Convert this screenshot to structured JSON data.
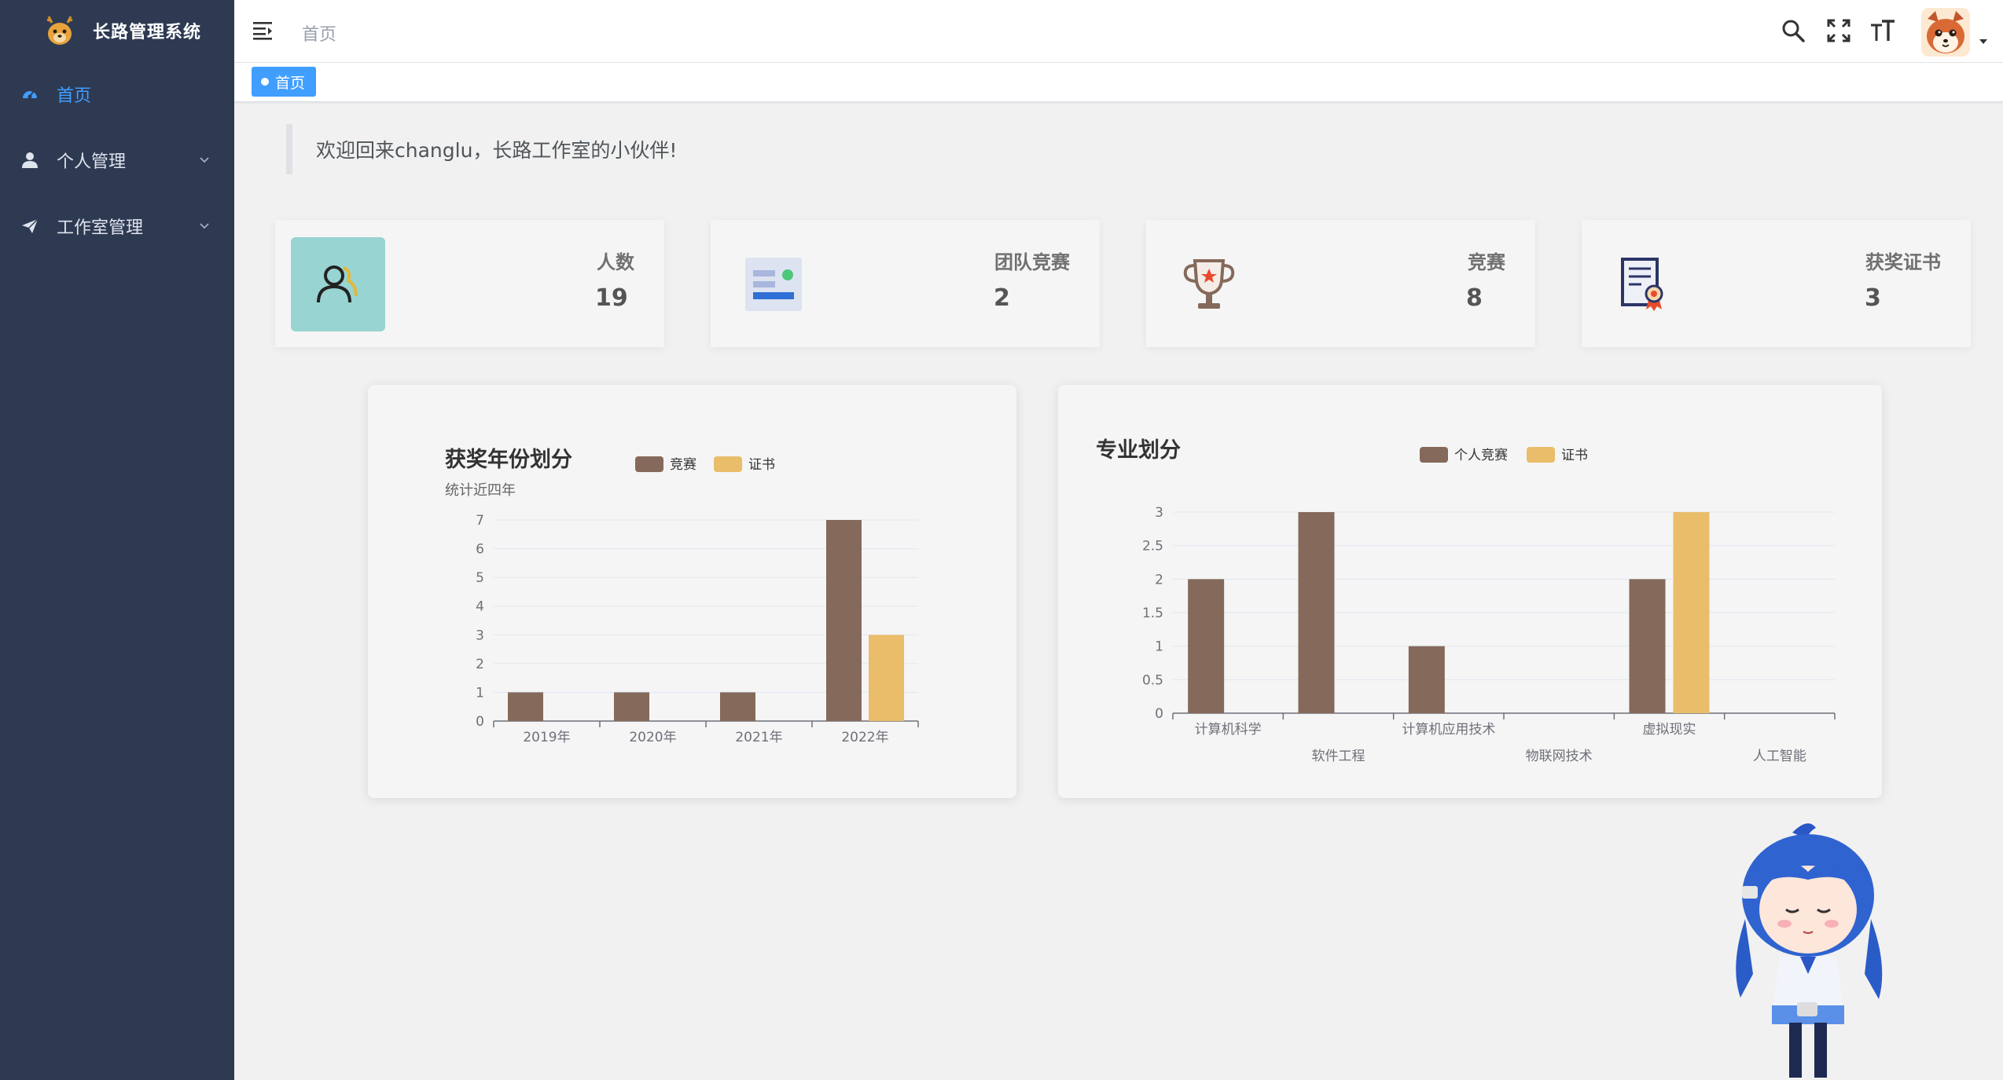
{
  "sidebar": {
    "brand_title": "长路管理系统",
    "items": [
      {
        "label": "首页",
        "icon": "dashboard-icon",
        "active": true
      },
      {
        "label": "个人管理",
        "icon": "user-icon",
        "expandable": true
      },
      {
        "label": "工作室管理",
        "icon": "paper-plane-icon",
        "expandable": true
      }
    ],
    "bg_color": "#2e3a52",
    "active_color": "#409eff"
  },
  "header": {
    "breadcrumb": "首页",
    "icons": [
      "search-icon",
      "fullscreen-icon",
      "font-size-icon"
    ]
  },
  "tags": [
    {
      "label": "首页",
      "active": true
    }
  ],
  "welcome_text": "欢迎回来changlu，长路工作室的小伙伴!",
  "stats": [
    {
      "label": "人数",
      "value": "19",
      "icon": "people-icon"
    },
    {
      "label": "团队竞赛",
      "value": "2",
      "icon": "team-card-icon"
    },
    {
      "label": "竞赛",
      "value": "8",
      "icon": "trophy-icon"
    },
    {
      "label": "获奖证书",
      "value": "3",
      "icon": "certificate-icon"
    }
  ],
  "chart_data": [
    {
      "type": "bar",
      "title": "获奖年份划分",
      "subtitle": "统计近四年",
      "categories": [
        "2019年",
        "2020年",
        "2021年",
        "2022年"
      ],
      "series": [
        {
          "name": "竞赛",
          "values": [
            1,
            1,
            1,
            7
          ],
          "color": "#85695a"
        },
        {
          "name": "证书",
          "values": [
            0,
            0,
            0,
            3
          ],
          "color": "#e9bd6a"
        }
      ],
      "ylim": [
        0,
        7
      ],
      "yticks": [
        "0",
        "1",
        "2",
        "3",
        "4",
        "5",
        "6",
        "7"
      ],
      "grid": true,
      "legend": "top"
    },
    {
      "type": "bar",
      "title": "专业划分",
      "categories": [
        "计算机科学",
        "软件工程",
        "计算机应用技术",
        "物联网技术",
        "虚拟现实",
        "人工智能"
      ],
      "series": [
        {
          "name": "个人竞赛",
          "values": [
            2,
            3,
            1,
            0,
            2,
            0
          ],
          "color": "#85695a"
        },
        {
          "name": "证书",
          "values": [
            0,
            0,
            0,
            0,
            3,
            0
          ],
          "color": "#e9bd6a"
        }
      ],
      "ylim": [
        0,
        3
      ],
      "yticks": [
        "0",
        "0.5",
        "1",
        "1.5",
        "2",
        "2.5",
        "3"
      ],
      "grid": true,
      "legend": "top"
    }
  ]
}
